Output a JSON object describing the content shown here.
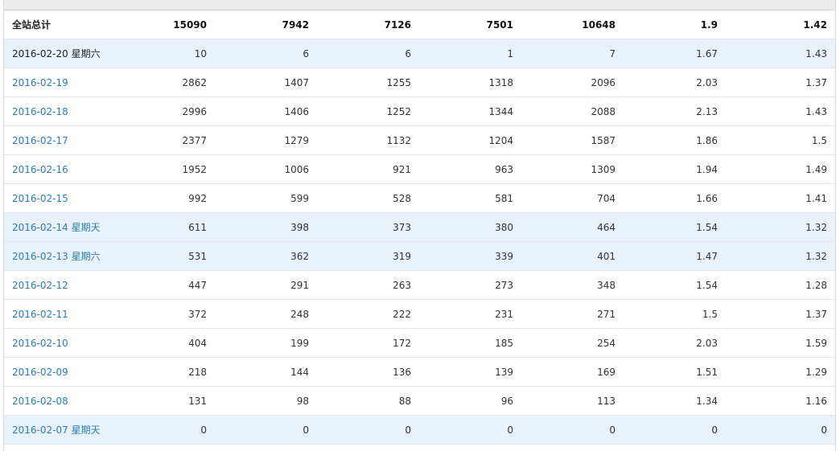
{
  "table": {
    "rows": [
      {
        "date": "全站总计",
        "week": "",
        "kind": "total",
        "link": false,
        "values": [
          "15090",
          "7942",
          "7126",
          "7501",
          "10648",
          "1.9",
          "1.42"
        ]
      },
      {
        "date": "2016-02-20",
        "week": "星期六",
        "kind": "highlight",
        "link": false,
        "values": [
          "10",
          "6",
          "6",
          "1",
          "7",
          "1.67",
          "1.43"
        ]
      },
      {
        "date": "2016-02-19",
        "week": "",
        "kind": "normal",
        "link": true,
        "values": [
          "2862",
          "1407",
          "1255",
          "1318",
          "2096",
          "2.03",
          "1.37"
        ]
      },
      {
        "date": "2016-02-18",
        "week": "",
        "kind": "normal",
        "link": true,
        "values": [
          "2996",
          "1406",
          "1252",
          "1344",
          "2088",
          "2.13",
          "1.43"
        ]
      },
      {
        "date": "2016-02-17",
        "week": "",
        "kind": "normal",
        "link": true,
        "values": [
          "2377",
          "1279",
          "1132",
          "1204",
          "1587",
          "1.86",
          "1.5"
        ]
      },
      {
        "date": "2016-02-16",
        "week": "",
        "kind": "normal",
        "link": true,
        "values": [
          "1952",
          "1006",
          "921",
          "963",
          "1309",
          "1.94",
          "1.49"
        ]
      },
      {
        "date": "2016-02-15",
        "week": "",
        "kind": "normal",
        "link": true,
        "values": [
          "992",
          "599",
          "528",
          "581",
          "704",
          "1.66",
          "1.41"
        ]
      },
      {
        "date": "2016-02-14",
        "week": "星期天",
        "kind": "highlight",
        "link": true,
        "values": [
          "611",
          "398",
          "373",
          "380",
          "464",
          "1.54",
          "1.32"
        ]
      },
      {
        "date": "2016-02-13",
        "week": "星期六",
        "kind": "highlight",
        "link": true,
        "values": [
          "531",
          "362",
          "319",
          "339",
          "401",
          "1.47",
          "1.32"
        ]
      },
      {
        "date": "2016-02-12",
        "week": "",
        "kind": "normal",
        "link": true,
        "values": [
          "447",
          "291",
          "263",
          "273",
          "348",
          "1.54",
          "1.28"
        ]
      },
      {
        "date": "2016-02-11",
        "week": "",
        "kind": "normal",
        "link": true,
        "values": [
          "372",
          "248",
          "222",
          "231",
          "271",
          "1.5",
          "1.37"
        ]
      },
      {
        "date": "2016-02-10",
        "week": "",
        "kind": "normal",
        "link": true,
        "values": [
          "404",
          "199",
          "172",
          "185",
          "254",
          "2.03",
          "1.59"
        ]
      },
      {
        "date": "2016-02-09",
        "week": "",
        "kind": "normal",
        "link": true,
        "values": [
          "218",
          "144",
          "136",
          "139",
          "169",
          "1.51",
          "1.29"
        ]
      },
      {
        "date": "2016-02-08",
        "week": "",
        "kind": "normal",
        "link": true,
        "values": [
          "131",
          "98",
          "88",
          "96",
          "113",
          "1.34",
          "1.16"
        ]
      },
      {
        "date": "2016-02-07",
        "week": "星期天",
        "kind": "highlight",
        "link": true,
        "values": [
          "0",
          "0",
          "0",
          "0",
          "0",
          "0",
          "0"
        ]
      }
    ]
  },
  "colors": {
    "link": "#2a7db8",
    "highlight_row": "#eaf2f9",
    "header_bg": "#ececec"
  }
}
